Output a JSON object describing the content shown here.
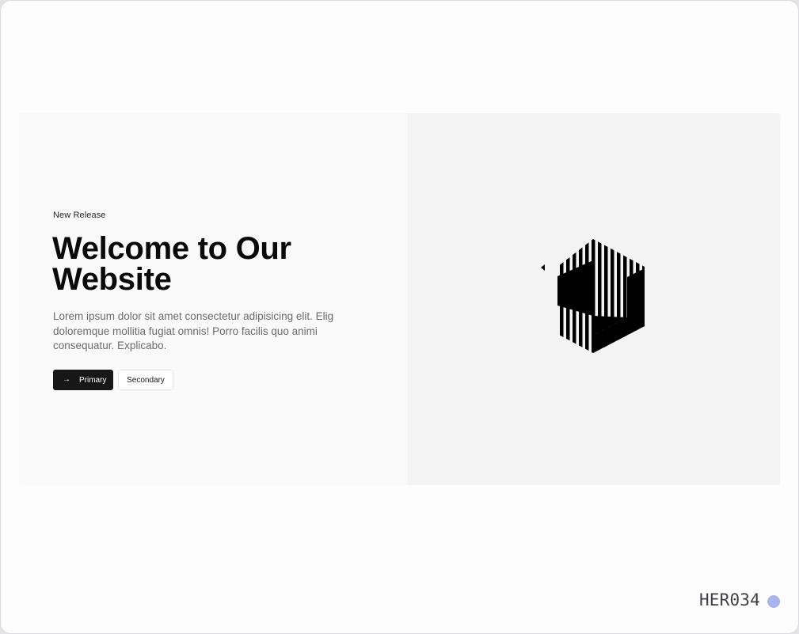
{
  "hero": {
    "eyebrow": "New Release",
    "title": "Welcome to Our Website",
    "description": "Lorem ipsum dolor sit amet consectetur adipisicing elit. Elig doloremque mollitia fugiat omnis! Porro facilis quo animi consequatur. Explicabo.",
    "primary_button": {
      "label": "Primary",
      "icon": "arrow-right-icon"
    },
    "secondary_button": {
      "label": "Secondary"
    },
    "logo_icon": "striped-hexagon-logo"
  },
  "footer_tag": {
    "code": "HER034",
    "dot_color": "#aab4ef"
  },
  "colors": {
    "left_panel": "#f9f9f9",
    "right_panel": "#f3f3f3",
    "primary_button": "#171717",
    "text_dark": "#0a0a0a",
    "text_muted": "#6b6b6b"
  }
}
